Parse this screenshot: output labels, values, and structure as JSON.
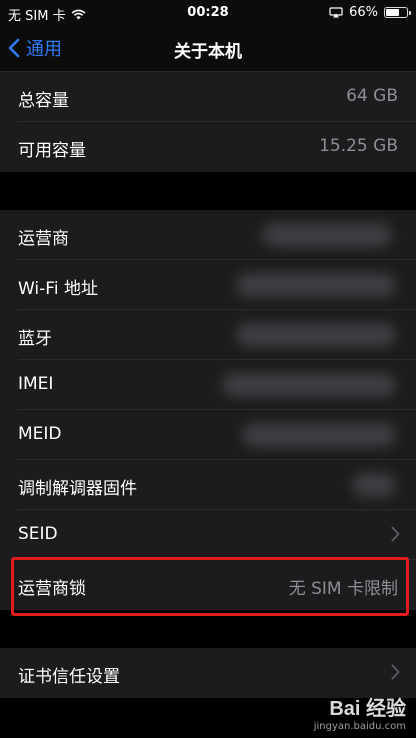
{
  "status_bar": {
    "carrier": "无 SIM 卡",
    "time": "00:28",
    "battery": "66%"
  },
  "nav": {
    "back_label": "通用",
    "title": "关于本机"
  },
  "storage_rows": [
    {
      "label": "总容量",
      "value": "64 GB"
    },
    {
      "label": "可用容量",
      "value": "15.25 GB"
    }
  ],
  "info_rows": [
    {
      "label": "运营商"
    },
    {
      "label": "Wi-Fi 地址"
    },
    {
      "label": "蓝牙"
    },
    {
      "label": "IMEI"
    },
    {
      "label": "MEID"
    },
    {
      "label": "调制解调器固件"
    },
    {
      "label": "SEID"
    },
    {
      "label": "运营商锁",
      "value": "无 SIM 卡限制"
    }
  ],
  "cert_row": {
    "label": "证书信任设置"
  },
  "watermark": {
    "brand": "Bai 经验",
    "url": "jingyan.baidu.com"
  },
  "colors": {
    "accent": "#2f7cf6",
    "highlight": "#e01c1c",
    "cell_bg": "#1c1c1e",
    "secondary_text": "#8e8e93"
  },
  "battery_level": 0.66
}
